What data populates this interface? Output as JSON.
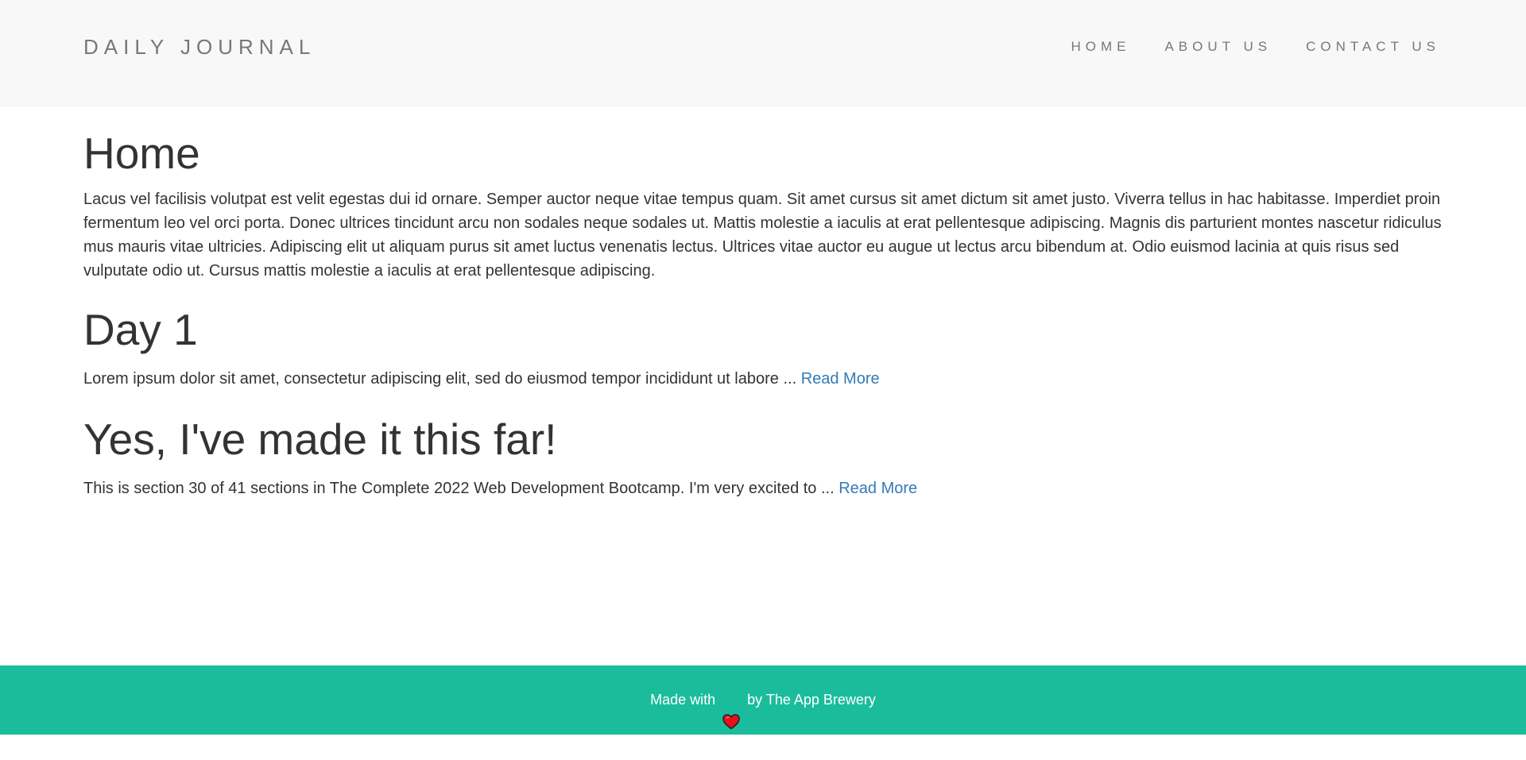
{
  "navbar": {
    "brand": "DAILY JOURNAL",
    "links": [
      "HOME",
      "ABOUT US",
      "CONTACT US"
    ]
  },
  "home": {
    "title": "Home",
    "content": "Lacus vel facilisis volutpat est velit egestas dui id ornare. Semper auctor neque vitae tempus quam. Sit amet cursus sit amet dictum sit amet justo. Viverra tellus in hac habitasse. Imperdiet proin fermentum leo vel orci porta. Donec ultrices tincidunt arcu non sodales neque sodales ut. Mattis molestie a iaculis at erat pellentesque adipiscing. Magnis dis parturient montes nascetur ridiculus mus mauris vitae ultricies. Adipiscing elit ut aliquam purus sit amet luctus venenatis lectus. Ultrices vitae auctor eu augue ut lectus arcu bibendum at. Odio euismod lacinia at quis risus sed vulputate odio ut. Cursus mattis molestie a iaculis at erat pellentesque adipiscing."
  },
  "posts": [
    {
      "title": "Day 1",
      "excerpt": "Lorem ipsum dolor sit amet, consectetur adipiscing elit, sed do eiusmod tempor incididunt ut labore ...",
      "read_more": "Read More"
    },
    {
      "title": "Yes, I've made it this far!",
      "excerpt": "This is section 30 of 41 sections in The Complete 2022 Web Development Bootcamp. I'm very excited to ...",
      "read_more": "Read More"
    }
  ],
  "footer": {
    "made_with": "Made with",
    "icon": "heart-icon",
    "by": "by The App Brewery"
  },
  "colors": {
    "navbar_bg": "#f8f8f8",
    "footer_bg": "#1abc9c",
    "link": "#337ab7",
    "heart": "#e8101c"
  }
}
